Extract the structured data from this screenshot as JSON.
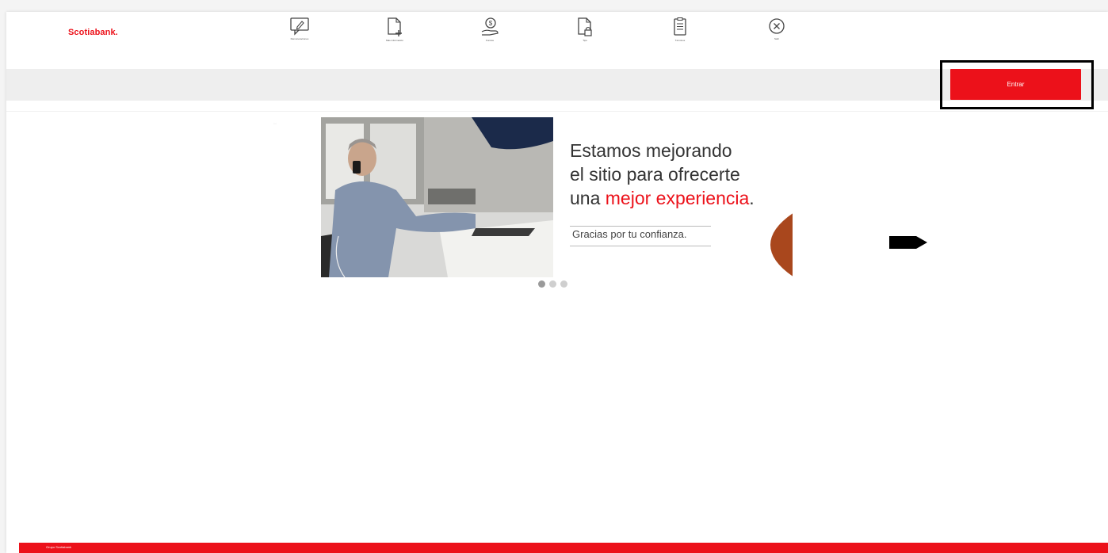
{
  "header": {
    "logo": "Scotiabank.",
    "nav": [
      {
        "label": "Remuneraciones",
        "icon": "message-edit-icon"
      },
      {
        "label": "Más información",
        "icon": "document-plus-icon"
      },
      {
        "label": "Fondos",
        "icon": "money-hand-icon"
      },
      {
        "label": "Tips",
        "icon": "document-lock-icon"
      },
      {
        "label": "Términos",
        "icon": "clipboard-icon"
      },
      {
        "label": "Salir",
        "icon": "close-circle-icon"
      }
    ]
  },
  "login": {
    "label": "Entrar"
  },
  "banner": {
    "line1": "Estamos mejorando",
    "line2": "el sitio para ofrecerte",
    "line3_prefix": "una ",
    "line3_accent": "mejor experiencia",
    "line3_suffix": ".",
    "subtitle": "Gracias por tu confianza.",
    "slides": 3,
    "active_slide": 1
  },
  "footer": {
    "text": "Grupo Scotiabank"
  },
  "colors": {
    "brand_red": "#ec111a",
    "gray_bar": "#eeeeee"
  }
}
